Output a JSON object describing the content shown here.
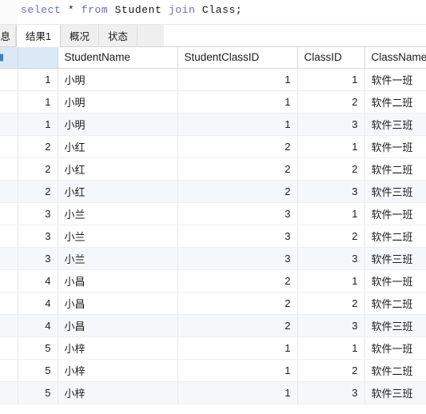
{
  "editor": {
    "sql_tokens": [
      {
        "t": "select",
        "k": "kw"
      },
      {
        "t": " ",
        "k": "sp"
      },
      {
        "t": "*",
        "k": "op"
      },
      {
        "t": " ",
        "k": "sp"
      },
      {
        "t": "from",
        "k": "kw"
      },
      {
        "t": " ",
        "k": "sp"
      },
      {
        "t": "Student",
        "k": "idf"
      },
      {
        "t": " ",
        "k": "sp"
      },
      {
        "t": "join",
        "k": "kw"
      },
      {
        "t": " ",
        "k": "sp"
      },
      {
        "t": "Class;",
        "k": "idf"
      }
    ],
    "sql_text": "select * from Student join Class;",
    "keyword_color": "#6a6aca",
    "identifier_color": "#151515"
  },
  "tabs": [
    {
      "label": "息",
      "active": false,
      "clipped": true
    },
    {
      "label": "结果1",
      "active": true,
      "clipped": false
    },
    {
      "label": "概况",
      "active": false,
      "clipped": false
    },
    {
      "label": "状态",
      "active": false,
      "clipped": false
    }
  ],
  "grid": {
    "selected_header_color": "#dbe9f6",
    "alt_row_color": "#f5f8fa",
    "columns": [
      {
        "key": "rownum",
        "label": "",
        "align": "left"
      },
      {
        "key": "id",
        "label": "",
        "align": "right"
      },
      {
        "key": "StudentName",
        "label": "StudentName",
        "align": "left"
      },
      {
        "key": "StudentClassID",
        "label": "StudentClassID",
        "align": "right"
      },
      {
        "key": "ClassID",
        "label": "ClassID",
        "align": "right"
      },
      {
        "key": "ClassName",
        "label": "ClassName",
        "align": "left"
      }
    ],
    "rows": [
      {
        "id": "1",
        "StudentName": "小明",
        "StudentClassID": "1",
        "ClassID": "1",
        "ClassName": "软件一班"
      },
      {
        "id": "1",
        "StudentName": "小明",
        "StudentClassID": "1",
        "ClassID": "2",
        "ClassName": "软件二班"
      },
      {
        "id": "1",
        "StudentName": "小明",
        "StudentClassID": "1",
        "ClassID": "3",
        "ClassName": "软件三班"
      },
      {
        "id": "2",
        "StudentName": "小红",
        "StudentClassID": "2",
        "ClassID": "1",
        "ClassName": "软件一班"
      },
      {
        "id": "2",
        "StudentName": "小红",
        "StudentClassID": "2",
        "ClassID": "2",
        "ClassName": "软件二班"
      },
      {
        "id": "2",
        "StudentName": "小红",
        "StudentClassID": "2",
        "ClassID": "3",
        "ClassName": "软件三班"
      },
      {
        "id": "3",
        "StudentName": "小兰",
        "StudentClassID": "3",
        "ClassID": "1",
        "ClassName": "软件一班"
      },
      {
        "id": "3",
        "StudentName": "小兰",
        "StudentClassID": "3",
        "ClassID": "2",
        "ClassName": "软件二班"
      },
      {
        "id": "3",
        "StudentName": "小兰",
        "StudentClassID": "3",
        "ClassID": "3",
        "ClassName": "软件三班"
      },
      {
        "id": "4",
        "StudentName": "小昌",
        "StudentClassID": "2",
        "ClassID": "1",
        "ClassName": "软件一班"
      },
      {
        "id": "4",
        "StudentName": "小昌",
        "StudentClassID": "2",
        "ClassID": "2",
        "ClassName": "软件二班"
      },
      {
        "id": "4",
        "StudentName": "小昌",
        "StudentClassID": "2",
        "ClassID": "3",
        "ClassName": "软件三班"
      },
      {
        "id": "5",
        "StudentName": "小梓",
        "StudentClassID": "1",
        "ClassID": "1",
        "ClassName": "软件一班"
      },
      {
        "id": "5",
        "StudentName": "小梓",
        "StudentClassID": "1",
        "ClassID": "2",
        "ClassName": "软件二班"
      },
      {
        "id": "5",
        "StudentName": "小梓",
        "StudentClassID": "1",
        "ClassID": "3",
        "ClassName": "软件三班"
      }
    ]
  }
}
